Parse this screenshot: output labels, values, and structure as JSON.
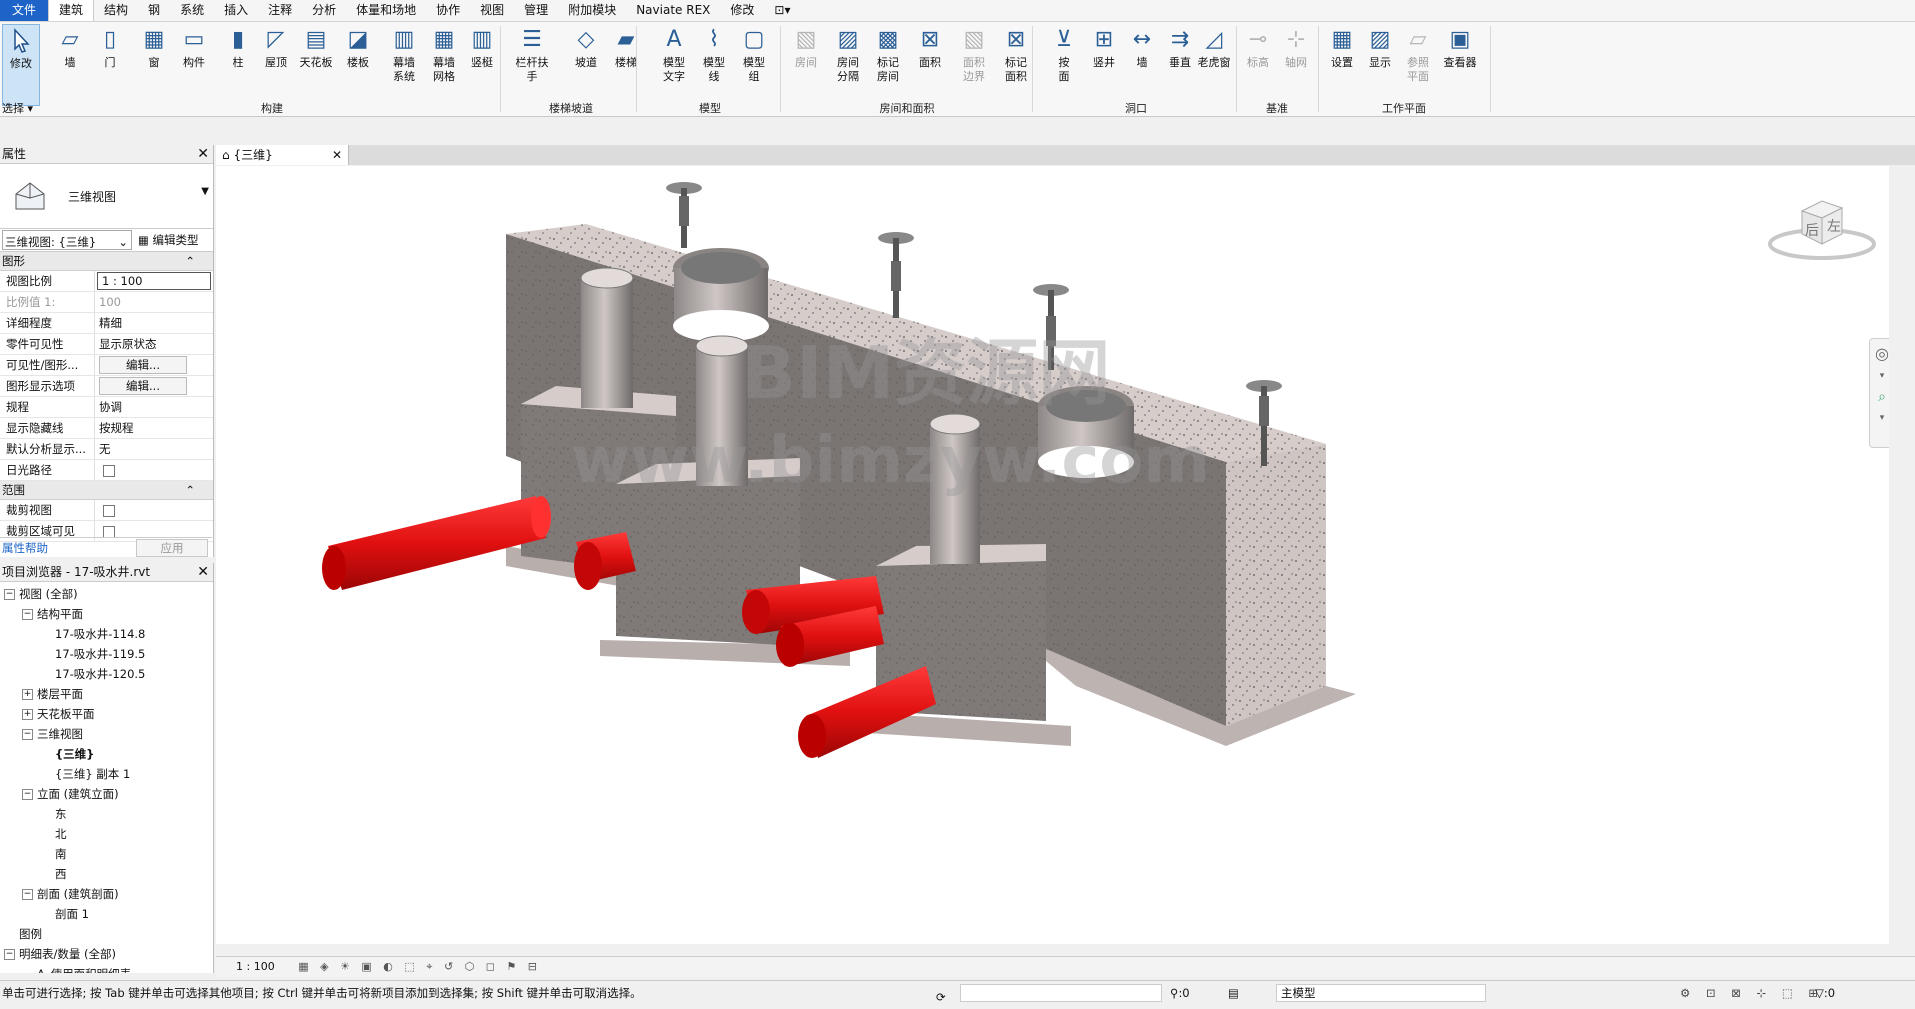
{
  "menu": {
    "items": [
      "文件",
      "建筑",
      "结构",
      "钢",
      "系统",
      "插入",
      "注释",
      "分析",
      "体量和场地",
      "协作",
      "视图",
      "管理",
      "附加模块",
      "Naviate REX",
      "修改"
    ]
  },
  "ribbon": {
    "select": {
      "modify_label": "修改",
      "dropdown_label": "选择"
    },
    "buttons": [
      {
        "label": "墙",
        "disabled": false
      },
      {
        "label": "门",
        "disabled": false
      },
      {
        "label": "窗",
        "disabled": false
      },
      {
        "label": "构件",
        "disabled": false
      },
      {
        "label": "柱",
        "disabled": false
      },
      {
        "label": "屋顶",
        "disabled": false
      },
      {
        "label": "天花板",
        "disabled": false
      },
      {
        "label": "楼板",
        "disabled": false
      },
      {
        "label": "幕墙\n系统",
        "disabled": false
      },
      {
        "label": "幕墙\n网格",
        "disabled": false
      },
      {
        "label": "竖梃",
        "disabled": false
      },
      {
        "label": "栏杆扶手",
        "disabled": false
      },
      {
        "label": "坡道",
        "disabled": false
      },
      {
        "label": "楼梯",
        "disabled": false
      },
      {
        "label": "模型\n文字",
        "disabled": false
      },
      {
        "label": "模型\n线",
        "disabled": false
      },
      {
        "label": "模型\n组",
        "disabled": false
      },
      {
        "label": "房间",
        "disabled": true
      },
      {
        "label": "房间\n分隔",
        "disabled": false
      },
      {
        "label": "标记\n房间",
        "disabled": false
      },
      {
        "label": "面积",
        "disabled": false
      },
      {
        "label": "面积\n边界",
        "disabled": true
      },
      {
        "label": "标记\n面积",
        "disabled": false
      },
      {
        "label": "按\n面",
        "disabled": false
      },
      {
        "label": "竖井",
        "disabled": false
      },
      {
        "label": "墙",
        "disabled": false
      },
      {
        "label": "垂直",
        "disabled": false
      },
      {
        "label": "老虎窗",
        "disabled": false
      },
      {
        "label": "标高",
        "disabled": true
      },
      {
        "label": "轴网",
        "disabled": true
      },
      {
        "label": "设置",
        "disabled": false
      },
      {
        "label": "显示",
        "disabled": false
      },
      {
        "label": "参照\n平面",
        "disabled": true
      },
      {
        "label": "查看器",
        "disabled": false
      }
    ],
    "panels": [
      "构建",
      "楼梯坡道",
      "模型",
      "房间和面积",
      "洞口",
      "基准",
      "工作平面"
    ]
  },
  "properties": {
    "title": "属性",
    "type_name": "三维视图",
    "view_selector": "三维视图: {三维}",
    "edit_type": "编辑类型",
    "group_graphics": "图形",
    "rows": [
      {
        "key": "视图比例",
        "value": "1 : 100",
        "editable": true
      },
      {
        "key": "比例值 1:",
        "value": "100",
        "muted": true
      },
      {
        "key": "详细程度",
        "value": "精细"
      },
      {
        "key": "零件可见性",
        "value": "显示原状态"
      },
      {
        "key": "可见性/图形...",
        "value": "编辑...",
        "button": true
      },
      {
        "key": "图形显示选项",
        "value": "编辑...",
        "button": true
      },
      {
        "key": "规程",
        "value": "协调"
      },
      {
        "key": "显示隐藏线",
        "value": "按规程"
      },
      {
        "key": "默认分析显示...",
        "value": "无"
      },
      {
        "key": "日光路径",
        "value": "",
        "checkbox": true
      }
    ],
    "group_extents": "范围",
    "extent_rows": [
      {
        "key": "裁剪视图",
        "value": "",
        "checkbox": true
      },
      {
        "key": "裁剪区域可见",
        "value": "",
        "checkbox": true
      }
    ],
    "help_link": "属性帮助",
    "apply_label": "应用"
  },
  "browser": {
    "title": "项目浏览器 - 17-吸水井.rvt",
    "nodes": [
      {
        "level": 0,
        "toggle": "−",
        "label": "视图 (全部)"
      },
      {
        "level": 1,
        "toggle": "−",
        "label": "结构平面"
      },
      {
        "level": 2,
        "toggle": "",
        "label": "17-吸水井-114.8"
      },
      {
        "level": 2,
        "toggle": "",
        "label": "17-吸水井-119.5"
      },
      {
        "level": 2,
        "toggle": "",
        "label": "17-吸水井-120.5"
      },
      {
        "level": 1,
        "toggle": "+",
        "label": "楼层平面"
      },
      {
        "level": 1,
        "toggle": "+",
        "label": "天花板平面"
      },
      {
        "level": 1,
        "toggle": "−",
        "label": "三维视图"
      },
      {
        "level": 2,
        "toggle": "",
        "label": "{三维}",
        "bold": true
      },
      {
        "level": 2,
        "toggle": "",
        "label": "{三维} 副本 1"
      },
      {
        "level": 1,
        "toggle": "−",
        "label": "立面 (建筑立面)"
      },
      {
        "level": 2,
        "toggle": "",
        "label": "东"
      },
      {
        "level": 2,
        "toggle": "",
        "label": "北"
      },
      {
        "level": 2,
        "toggle": "",
        "label": "南"
      },
      {
        "level": 2,
        "toggle": "",
        "label": "西"
      },
      {
        "level": 1,
        "toggle": "−",
        "label": "剖面 (建筑剖面)"
      },
      {
        "level": 2,
        "toggle": "",
        "label": "剖面 1"
      },
      {
        "level": 0,
        "toggle": "",
        "label": "图例"
      },
      {
        "level": 0,
        "toggle": "−",
        "label": "明细表/数量 (全部)"
      },
      {
        "level": 1,
        "toggle": "",
        "label": "A_使用面积明细表"
      }
    ]
  },
  "view_tab": {
    "label": "{三维}"
  },
  "viewcube": {
    "back": "后",
    "left": "左"
  },
  "watermark": {
    "line1": "BIM资源网",
    "line2": "www.bimzyw.com"
  },
  "view_control": {
    "scale": "1 : 100"
  },
  "status": {
    "message": "单击可进行选择; 按 Tab 键并单击可选择其他项目; 按 Ctrl 键并单击可将新项目添加到选择集; 按 Shift 键并单击可取消选择。",
    "count_a": ":0",
    "model": "主模型",
    "count_b": ":0"
  },
  "colors": {
    "pipe": "#e01010",
    "concrete": "#c8bdbb",
    "concrete_dark": "#7a7472",
    "accent": "#1e64c8"
  }
}
